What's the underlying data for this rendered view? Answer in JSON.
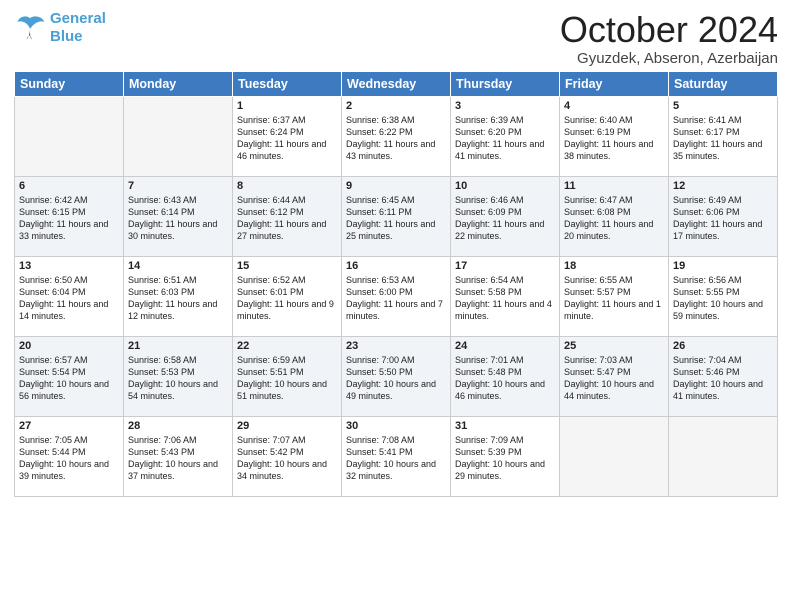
{
  "header": {
    "logo_line1": "General",
    "logo_line2": "Blue",
    "month_title": "October 2024",
    "subtitle": "Gyuzdek, Abseron, Azerbaijan"
  },
  "days_of_week": [
    "Sunday",
    "Monday",
    "Tuesday",
    "Wednesday",
    "Thursday",
    "Friday",
    "Saturday"
  ],
  "weeks": [
    [
      {
        "day": "",
        "empty": true
      },
      {
        "day": "",
        "empty": true
      },
      {
        "day": "1",
        "sunrise": "Sunrise: 6:37 AM",
        "sunset": "Sunset: 6:24 PM",
        "daylight": "Daylight: 11 hours and 46 minutes."
      },
      {
        "day": "2",
        "sunrise": "Sunrise: 6:38 AM",
        "sunset": "Sunset: 6:22 PM",
        "daylight": "Daylight: 11 hours and 43 minutes."
      },
      {
        "day": "3",
        "sunrise": "Sunrise: 6:39 AM",
        "sunset": "Sunset: 6:20 PM",
        "daylight": "Daylight: 11 hours and 41 minutes."
      },
      {
        "day": "4",
        "sunrise": "Sunrise: 6:40 AM",
        "sunset": "Sunset: 6:19 PM",
        "daylight": "Daylight: 11 hours and 38 minutes."
      },
      {
        "day": "5",
        "sunrise": "Sunrise: 6:41 AM",
        "sunset": "Sunset: 6:17 PM",
        "daylight": "Daylight: 11 hours and 35 minutes."
      }
    ],
    [
      {
        "day": "6",
        "sunrise": "Sunrise: 6:42 AM",
        "sunset": "Sunset: 6:15 PM",
        "daylight": "Daylight: 11 hours and 33 minutes."
      },
      {
        "day": "7",
        "sunrise": "Sunrise: 6:43 AM",
        "sunset": "Sunset: 6:14 PM",
        "daylight": "Daylight: 11 hours and 30 minutes."
      },
      {
        "day": "8",
        "sunrise": "Sunrise: 6:44 AM",
        "sunset": "Sunset: 6:12 PM",
        "daylight": "Daylight: 11 hours and 27 minutes."
      },
      {
        "day": "9",
        "sunrise": "Sunrise: 6:45 AM",
        "sunset": "Sunset: 6:11 PM",
        "daylight": "Daylight: 11 hours and 25 minutes."
      },
      {
        "day": "10",
        "sunrise": "Sunrise: 6:46 AM",
        "sunset": "Sunset: 6:09 PM",
        "daylight": "Daylight: 11 hours and 22 minutes."
      },
      {
        "day": "11",
        "sunrise": "Sunrise: 6:47 AM",
        "sunset": "Sunset: 6:08 PM",
        "daylight": "Daylight: 11 hours and 20 minutes."
      },
      {
        "day": "12",
        "sunrise": "Sunrise: 6:49 AM",
        "sunset": "Sunset: 6:06 PM",
        "daylight": "Daylight: 11 hours and 17 minutes."
      }
    ],
    [
      {
        "day": "13",
        "sunrise": "Sunrise: 6:50 AM",
        "sunset": "Sunset: 6:04 PM",
        "daylight": "Daylight: 11 hours and 14 minutes."
      },
      {
        "day": "14",
        "sunrise": "Sunrise: 6:51 AM",
        "sunset": "Sunset: 6:03 PM",
        "daylight": "Daylight: 11 hours and 12 minutes."
      },
      {
        "day": "15",
        "sunrise": "Sunrise: 6:52 AM",
        "sunset": "Sunset: 6:01 PM",
        "daylight": "Daylight: 11 hours and 9 minutes."
      },
      {
        "day": "16",
        "sunrise": "Sunrise: 6:53 AM",
        "sunset": "Sunset: 6:00 PM",
        "daylight": "Daylight: 11 hours and 7 minutes."
      },
      {
        "day": "17",
        "sunrise": "Sunrise: 6:54 AM",
        "sunset": "Sunset: 5:58 PM",
        "daylight": "Daylight: 11 hours and 4 minutes."
      },
      {
        "day": "18",
        "sunrise": "Sunrise: 6:55 AM",
        "sunset": "Sunset: 5:57 PM",
        "daylight": "Daylight: 11 hours and 1 minute."
      },
      {
        "day": "19",
        "sunrise": "Sunrise: 6:56 AM",
        "sunset": "Sunset: 5:55 PM",
        "daylight": "Daylight: 10 hours and 59 minutes."
      }
    ],
    [
      {
        "day": "20",
        "sunrise": "Sunrise: 6:57 AM",
        "sunset": "Sunset: 5:54 PM",
        "daylight": "Daylight: 10 hours and 56 minutes."
      },
      {
        "day": "21",
        "sunrise": "Sunrise: 6:58 AM",
        "sunset": "Sunset: 5:53 PM",
        "daylight": "Daylight: 10 hours and 54 minutes."
      },
      {
        "day": "22",
        "sunrise": "Sunrise: 6:59 AM",
        "sunset": "Sunset: 5:51 PM",
        "daylight": "Daylight: 10 hours and 51 minutes."
      },
      {
        "day": "23",
        "sunrise": "Sunrise: 7:00 AM",
        "sunset": "Sunset: 5:50 PM",
        "daylight": "Daylight: 10 hours and 49 minutes."
      },
      {
        "day": "24",
        "sunrise": "Sunrise: 7:01 AM",
        "sunset": "Sunset: 5:48 PM",
        "daylight": "Daylight: 10 hours and 46 minutes."
      },
      {
        "day": "25",
        "sunrise": "Sunrise: 7:03 AM",
        "sunset": "Sunset: 5:47 PM",
        "daylight": "Daylight: 10 hours and 44 minutes."
      },
      {
        "day": "26",
        "sunrise": "Sunrise: 7:04 AM",
        "sunset": "Sunset: 5:46 PM",
        "daylight": "Daylight: 10 hours and 41 minutes."
      }
    ],
    [
      {
        "day": "27",
        "sunrise": "Sunrise: 7:05 AM",
        "sunset": "Sunset: 5:44 PM",
        "daylight": "Daylight: 10 hours and 39 minutes."
      },
      {
        "day": "28",
        "sunrise": "Sunrise: 7:06 AM",
        "sunset": "Sunset: 5:43 PM",
        "daylight": "Daylight: 10 hours and 37 minutes."
      },
      {
        "day": "29",
        "sunrise": "Sunrise: 7:07 AM",
        "sunset": "Sunset: 5:42 PM",
        "daylight": "Daylight: 10 hours and 34 minutes."
      },
      {
        "day": "30",
        "sunrise": "Sunrise: 7:08 AM",
        "sunset": "Sunset: 5:41 PM",
        "daylight": "Daylight: 10 hours and 32 minutes."
      },
      {
        "day": "31",
        "sunrise": "Sunrise: 7:09 AM",
        "sunset": "Sunset: 5:39 PM",
        "daylight": "Daylight: 10 hours and 29 minutes."
      },
      {
        "day": "",
        "empty": true
      },
      {
        "day": "",
        "empty": true
      }
    ]
  ]
}
